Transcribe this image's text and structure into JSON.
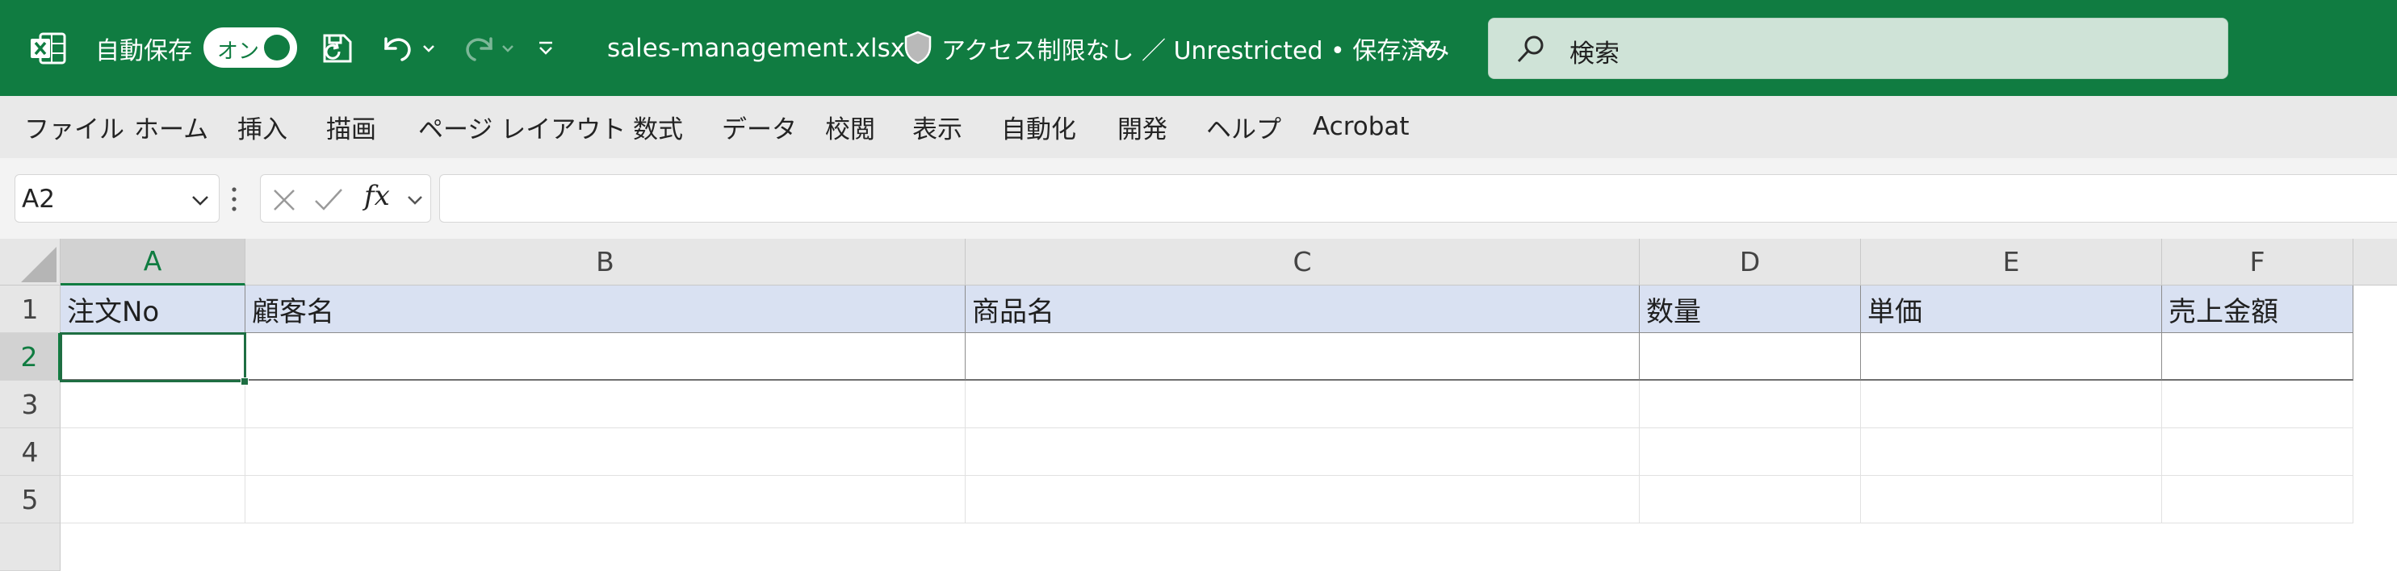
{
  "titlebar": {
    "app_icon": "excel-logo-icon",
    "autosave_label": "自動保存",
    "autosave_toggle": "オン",
    "filename": "sales-management.xlsx",
    "sensitivity": "アクセス制限なし ／ Unrestricted • 保存済み",
    "search_placeholder": "検索",
    "icons": [
      "save-sync-icon",
      "undo-icon",
      "redo-icon",
      "customize-toolbar-icon",
      "shield-icon",
      "search-icon"
    ]
  },
  "ribbon": {
    "tabs": [
      "ファイル",
      "ホーム",
      "挿入",
      "描画",
      "ページ レイアウト",
      "数式",
      "データ",
      "校閲",
      "表示",
      "自動化",
      "開発",
      "ヘルプ",
      "Acrobat"
    ]
  },
  "formula_bar": {
    "name_box": "A2",
    "fx": "fx",
    "formula": ""
  },
  "grid": {
    "columns": [
      "A",
      "B",
      "C",
      "D",
      "E",
      "F"
    ],
    "rows": [
      "1",
      "2",
      "3",
      "4",
      "5"
    ],
    "selected_cell": "A2",
    "header_row": [
      "注文No",
      "顧客名",
      "商品名",
      "数量",
      "単価",
      "売上金額"
    ],
    "header_fill": "#d9e1f2"
  },
  "colors": {
    "accent": "#107c41",
    "selection": "#1e6e42"
  }
}
